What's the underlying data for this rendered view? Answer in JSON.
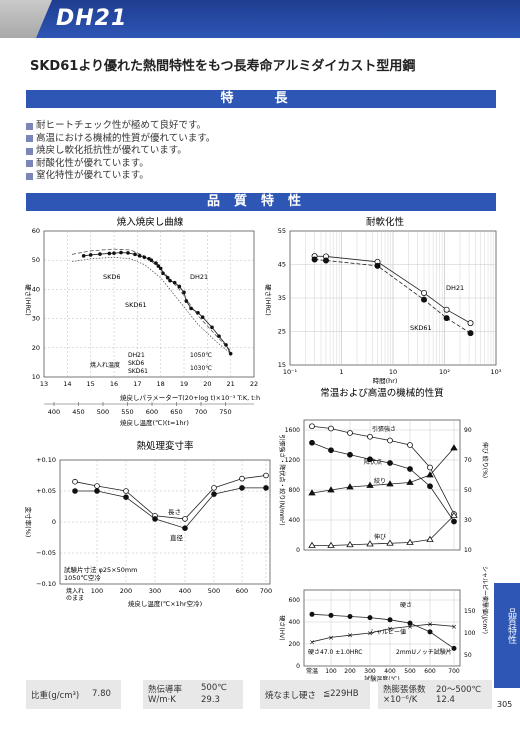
{
  "header": {
    "title": "DH21"
  },
  "subtitle": "SKD61より優れた熱間特性をもつ長寿命アルミダイカスト型用鋼",
  "features_heading": "特　長",
  "features": [
    "耐ヒートチェック性が極めて良好です。",
    "高温における機械的性質が優れています。",
    "焼戻し軟化抵抗性が優れています。",
    "耐酸化性が優れています。",
    "窒化特性が優れています。"
  ],
  "quality_heading": "品質特性",
  "side_tab": "品質特性",
  "page_number": "305",
  "footer": {
    "density_label": "比重(g/cm³)",
    "density_value": "7.80",
    "thermal_label": "熱伝導率",
    "thermal_temp": "500℃",
    "thermal_unit": "W/m·K",
    "thermal_value": "29.3",
    "anneal_label": "焼なまし硬さ",
    "anneal_value": "≦229HB",
    "expansion_label": "熱膨張係数",
    "expansion_temp": "20〜500℃",
    "expansion_unit": "×10⁻⁶/K",
    "expansion_value": "12.4"
  },
  "chart_data": [
    {
      "type": "scatter",
      "title": "焼入焼戻し曲線",
      "ylabel": "硬さ(HRC)",
      "xlabel": "焼戻しパラメーターT(20+log t)×10⁻³ T:K, t:h",
      "x2label": "焼戻し温度(℃)(t=1hr)",
      "ylim": [
        10,
        60
      ],
      "xlim": [
        13,
        22
      ],
      "yticks": [
        "10",
        "20",
        "30",
        "40",
        "50",
        "60"
      ],
      "xticks": [
        "13",
        "14",
        "15",
        "16",
        "17",
        "18",
        "19",
        "20",
        "21",
        "22"
      ],
      "x2ticks": [
        "400",
        "450",
        "500",
        "550",
        "600",
        "650",
        "700",
        "750"
      ],
      "annotations": [
        "SKD6",
        "DH21",
        "SKD61"
      ],
      "legend": {
        "header": "焼入れ温度",
        "rows": [
          [
            "DH21",
            "1050℃"
          ],
          [
            "SKD6",
            "1030℃"
          ],
          [
            "SKD61",
            ""
          ]
        ]
      },
      "points": [
        [
          14.7,
          51.5
        ],
        [
          15.0,
          51.8
        ],
        [
          15.4,
          52.1
        ],
        [
          15.8,
          52.3
        ],
        [
          16.0,
          52.4
        ],
        [
          16.3,
          52.6
        ],
        [
          16.6,
          52.5
        ],
        [
          16.9,
          52.0
        ],
        [
          17.1,
          51.5
        ],
        [
          17.3,
          51.0
        ],
        [
          17.5,
          50.5
        ],
        [
          17.6,
          50.0
        ],
        [
          17.8,
          49.0
        ],
        [
          17.9,
          48.0
        ],
        [
          18.0,
          47.2
        ],
        [
          18.1,
          45.5
        ],
        [
          18.3,
          44.0
        ],
        [
          18.4,
          43.0
        ],
        [
          18.6,
          42.3
        ],
        [
          18.8,
          41.0
        ],
        [
          19.0,
          39.0
        ],
        [
          19.1,
          36.0
        ],
        [
          19.3,
          33.5
        ],
        [
          19.6,
          32.0
        ],
        [
          19.8,
          30.5
        ],
        [
          20.2,
          27.0
        ],
        [
          20.5,
          24.0
        ],
        [
          20.8,
          21.0
        ],
        [
          21.0,
          18.0
        ]
      ]
    },
    {
      "type": "line",
      "title": "耐軟化性",
      "ylabel": "硬さ(HRC)",
      "xlabel": "時間(hr)",
      "ylim": [
        15,
        55
      ],
      "yticks": [
        "15",
        "25",
        "35",
        "45",
        "55"
      ],
      "xticks": [
        "10⁻¹",
        "1",
        "10",
        "10²",
        "10³"
      ],
      "series": [
        {
          "name": "DH21",
          "x": [
            0.3,
            0.5,
            5,
            40,
            110,
            320
          ],
          "y": [
            47.5,
            47.4,
            45.8,
            36.5,
            31.5,
            27.5
          ]
        },
        {
          "name": "SKD61",
          "x": [
            0.3,
            0.5,
            5,
            40,
            110,
            320
          ],
          "y": [
            46.5,
            46.2,
            44.6,
            34.5,
            29.0,
            24.5
          ]
        }
      ],
      "annotations": [
        "DH21",
        "SKD61"
      ]
    },
    {
      "type": "line",
      "title": "熱処理変寸率",
      "ylabel": "変寸率(%)",
      "xlabel": "焼戻し温度(℃×1hr空冷)",
      "ylim": [
        -0.1,
        0.1
      ],
      "yticks": [
        "+0.10",
        "+0.05",
        "0",
        "−0.05",
        "−0.10"
      ],
      "xticks": [
        "焼入れのまま",
        "100",
        "200",
        "300",
        "400",
        "500",
        "600",
        "700"
      ],
      "series": [
        {
          "name": "長さ",
          "values": [
            0.065,
            0.058,
            0.05,
            0.01,
            0.005,
            0.055,
            0.07,
            0.075
          ]
        },
        {
          "name": "直径",
          "values": [
            0.05,
            0.05,
            0.04,
            0.005,
            -0.01,
            0.045,
            0.055,
            0.055
          ]
        }
      ],
      "annotations": [
        "長さ",
        "直径"
      ],
      "note": [
        "試験片寸法 φ25×50mm",
        "1050℃空冷"
      ]
    },
    {
      "type": "line",
      "title": "常温および高温の機械的性質",
      "ylabel": "引張強さ・降伏点・絞り(N/mm²)",
      "ylabel_right": "伸び 絞り(%)",
      "yticks_left": [
        "0",
        "400",
        "800",
        "1200",
        "1600"
      ],
      "yticks_right": [
        "10",
        "30",
        "50",
        "70",
        "90"
      ],
      "xlabel": "試験温度(℃)",
      "xticks": [
        "常温",
        "100",
        "200",
        "300",
        "400",
        "500",
        "600",
        "700"
      ],
      "series": [
        {
          "name": "引張強さ",
          "values": [
            1650,
            1620,
            1560,
            1510,
            1460,
            1400,
            1100,
            480
          ]
        },
        {
          "name": "降伏点",
          "values": [
            1430,
            1330,
            1270,
            1210,
            1160,
            1080,
            850,
            380
          ]
        },
        {
          "name": "絞り",
          "values": [
            48,
            50,
            52,
            53,
            54,
            55,
            60,
            78
          ]
        },
        {
          "name": "伸び",
          "values": [
            13,
            13,
            13.5,
            14,
            14.5,
            15,
            17,
            33
          ]
        }
      ],
      "lower": {
        "ylabel": "硬さ(HV)",
        "ylabel_right": "シャルピー衝撃値(J/cm²)",
        "yticks_left": [
          "0",
          "200",
          "400",
          "600"
        ],
        "yticks_right": [
          "50",
          "100",
          "150"
        ],
        "series": [
          {
            "name": "硬さ",
            "values": [
              470,
              460,
              450,
              440,
              420,
              390,
              310,
              160
            ]
          },
          {
            "name": "シャルピー値",
            "values": [
              80,
              90,
              95,
              100,
              110,
              115,
              120,
              115
            ]
          }
        ],
        "annotations": [
          "硬さ",
          "シャルピー値",
          "硬さ47.0 ±1.0HRC",
          "2mmUノッチ試験片"
        ]
      }
    }
  ]
}
